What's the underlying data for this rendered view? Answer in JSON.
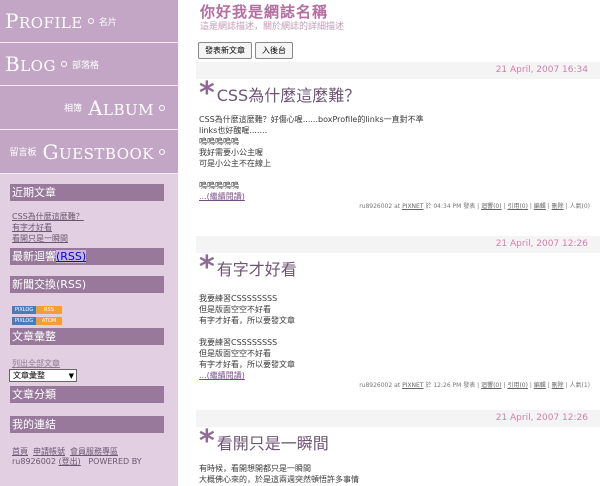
{
  "nav": [
    {
      "big": "Profile",
      "sub": "名片"
    },
    {
      "big": "Blog",
      "sub": "部落格"
    },
    {
      "big": "Album",
      "sub": "相簿"
    },
    {
      "big": "Guestbook",
      "sub": "留言板"
    }
  ],
  "sidebar": {
    "recent_head": "近期文章",
    "recent_items": [
      "CSS為什麼這麼難？",
      "有字才好看",
      "看開只是一瞬間"
    ],
    "latest_comments_head": "最新迴響",
    "latest_comments_rss": "(RSS)",
    "news_head": "新聞交換(RSS)",
    "feed1_a": "PIXLOG",
    "feed1_b": "RSS",
    "feed2_a": "PIXLOG",
    "feed2_b": "ATOM",
    "archive_head": "文章彙整",
    "archive_link": "列出全部文章",
    "archive_select": "文章彙整",
    "category_head": "文章分類",
    "links_head": "我的連結",
    "footer_links": [
      "首頁",
      "申請帳號",
      "會員服務專區"
    ],
    "footer_user": "ru8926002",
    "footer_logout": "(登出)",
    "footer_powered": "POWERED BY"
  },
  "header": {
    "title": "你好我是網誌名稱",
    "desc": "這是網誌描述，關於網誌的詳細描述",
    "btn_new": "發表新文章",
    "btn_admin": "入後台"
  },
  "posts": [
    {
      "date": "21 April, 2007 16:34",
      "title": "CSS為什麼這麼難？",
      "body": [
        "CSS為什麼這麼難？好傷心喔......boxProfile的links一直對不準",
        "links也好醜喔.......",
        "嗚嗚嗚嗚嗚",
        "我好需要小公主喔",
        "可是小公主不在線上",
        "",
        "嗚嗚嗚嗚嗚"
      ],
      "more": "...(繼續閱讀)",
      "meta_user": "ru8926002",
      "meta_at": "at",
      "meta_site": "PIXNET",
      "meta_time": "於 04:34 PM 發表",
      "meta_comment": "迴響(0)",
      "meta_trackback": "引用(0)",
      "meta_edit": "編輯",
      "meta_delete": "刪除",
      "meta_views": "人氣(0)"
    },
    {
      "date": "21 April, 2007 12:26",
      "title": "有字才好看",
      "body": [
        "我要練習CSSSSSSSS",
        "但是版面空空不好看",
        "有字才好看，所以要發文章",
        "",
        "我要練習CSSSSSSSS",
        "但是版面空空不好看",
        "有字才好看，所以要發文章"
      ],
      "more": "...(繼續閱讀)",
      "meta_user": "ru8926002",
      "meta_at": "at",
      "meta_site": "PIXNET",
      "meta_time": "於 12:26 PM 發表",
      "meta_comment": "迴響(0)",
      "meta_trackback": "引用(0)",
      "meta_edit": "編輯",
      "meta_delete": "刪除",
      "meta_views": "人氣(1)"
    },
    {
      "date": "21 April, 2007 12:26",
      "title": "看開只是一瞬間",
      "body": [
        "有時候，看開想開都只是一瞬間",
        "大概佛心來的，於是這兩週突然頓悟許多事情"
      ]
    }
  ]
}
